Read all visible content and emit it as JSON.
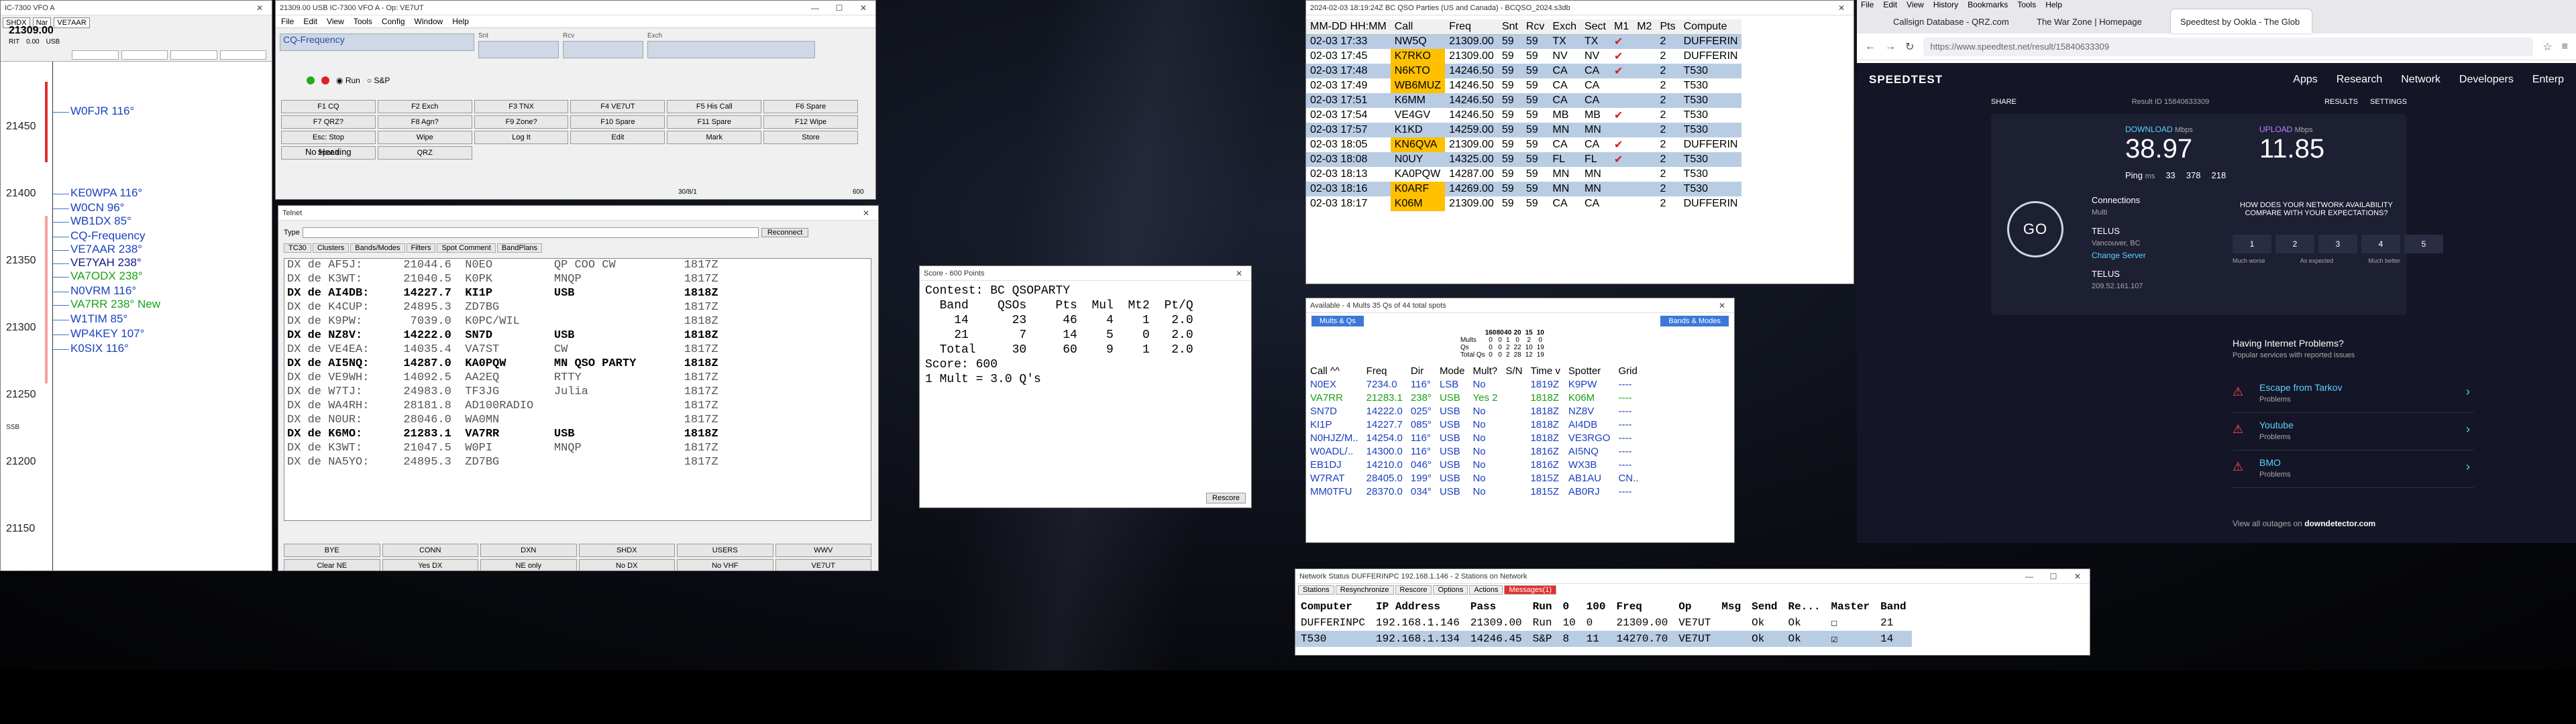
{
  "bandmap": {
    "title": "IC-7300 VFO A",
    "freq": "21309.00",
    "buttons": [
      "SHDX",
      "Nar",
      "VE7AAR"
    ],
    "rit": "RIT",
    "rit_val": "0.00",
    "mode": "USB",
    "ticks": [
      "21450",
      "21400",
      "21350",
      "21300",
      "21250",
      "21200",
      "21150"
    ],
    "spots": [
      {
        "t": "W0FJR 116°",
        "c": "#1a40c0"
      },
      {
        "t": "KE0WPA 116°",
        "c": "#1a40c0"
      },
      {
        "t": "W0CN 96°",
        "c": "#1a40c0"
      },
      {
        "t": "WB1DX 85°",
        "c": "#1a40c0"
      },
      {
        "t": "CQ-Frequency",
        "c": "#1a40c0"
      },
      {
        "t": "VE7AAR 238°",
        "c": "#1a40c0"
      },
      {
        "t": "VE7YAH 238°",
        "c": "#0a1a80"
      },
      {
        "t": "VA7ODX 238°",
        "c": "#18a018"
      },
      {
        "t": "N0VRM 116°",
        "c": "#1a40c0"
      },
      {
        "t": "VA7RR 238° New",
        "c": "#18a018"
      },
      {
        "t": "W1TIM 85°",
        "c": "#1a40c0"
      },
      {
        "t": "WP4KEY 107°",
        "c": "#1a40c0"
      },
      {
        "t": "K0SIX 116°",
        "c": "#1a40c0"
      }
    ],
    "sub_label": "SSB"
  },
  "logger": {
    "title": "21309.00 USB IC-7300 VFO A - Op: VE7UT",
    "menus": [
      "File",
      "Edit",
      "View",
      "Tools",
      "Config",
      "Window",
      "Help"
    ],
    "fields": [
      {
        "l": "",
        "v": "CQ-Frequency"
      },
      {
        "l": "Snt",
        "v": ""
      },
      {
        "l": "Rcv",
        "v": ""
      },
      {
        "l": "Exch",
        "v": ""
      }
    ],
    "run": "Run",
    "sp": "S&P",
    "fkeys": [
      "F1 CQ",
      "F2 Exch",
      "F3 TNX",
      "F4 VE7UT",
      "F5 His Call",
      "F6 Spare",
      "F7 QRZ?",
      "F8 Agn?",
      "F9 Zone?",
      "F10 Spare",
      "F11 Spare",
      "F12 Wipe",
      "Esc: Stop",
      "Wipe",
      "Log It",
      "Edit",
      "Mark",
      "Store",
      "Spot It",
      "QRZ"
    ],
    "heading": "No Heading",
    "status_a": "30/8/1",
    "status_b": "600"
  },
  "telnet": {
    "title": "Telnet",
    "type_label": "Type",
    "reconnect": "Reconnect",
    "tabs": [
      "TC30",
      "Clusters",
      "Bands/Modes",
      "Filters",
      "Spot Comment",
      "BandPlans"
    ],
    "rows": [
      {
        "t": "DX de AF5J:      21044.6  N0EO         QP COO CW          1817Z",
        "b": false
      },
      {
        "t": "DX de K3WT:      21040.5  K0PK         MNQP               1817Z",
        "b": false
      },
      {
        "t": "DX de AI4DB:     14227.7  KI1P         USB                1818Z",
        "b": true
      },
      {
        "t": "DX de K4CUP:     24895.3  ZD7BG                           1817Z",
        "b": false
      },
      {
        "t": "DX de K9PW:       7039.0  K0PC/WIL                        1818Z",
        "b": false
      },
      {
        "t": "DX de NZ8V:      14222.0  SN7D         USB                1818Z",
        "b": true
      },
      {
        "t": "DX de VE4EA:     14035.4  VA7ST        CW                 1817Z",
        "b": false
      },
      {
        "t": "DX de AI5NQ:     14287.0  KA0PQW       MN QSO PARTY       1818Z",
        "b": true
      },
      {
        "t": "DX de VE9WH:     14092.5  AA2EQ        RTTY               1817Z",
        "b": false
      },
      {
        "t": "DX de W7TJ:      24983.0  TF3JG        Julia              1817Z",
        "b": false
      },
      {
        "t": "DX de WA4RH:     28181.8  AD100RADIO                      1817Z",
        "b": false
      },
      {
        "t": "DX de N0UR:      28046.0  WA0MN                           1817Z",
        "b": false
      },
      {
        "t": "DX de K6MO:      21283.1  VA7RR        USB                1818Z",
        "b": true
      },
      {
        "t": "DX de K3WT:      21047.5  W0PI         MNQP               1817Z",
        "b": false
      },
      {
        "t": "DX de NA5YO:     24895.3  ZD7BG                           1817Z",
        "b": false
      }
    ],
    "buttons": [
      "BYE",
      "CONN",
      "DXN",
      "SHDX",
      "USERS",
      "WWV",
      "Clear NE",
      "Yes DX",
      "NE only",
      "No DX",
      "No VHF",
      "VE7UT"
    ]
  },
  "score": {
    "title": "Score - 600 Points",
    "text": "Contest: BC QSOPARTY\n  Band    QSOs    Pts  Mul  Mt2  Pt/Q\n    14      23     46    4    1   2.0\n    21       7     14    5    0   2.0\n  Total     30     60    9    1   2.0\nScore: 600\n1 Mult = 3.0 Q's",
    "rescore": "Rescore"
  },
  "log": {
    "title": "2024-02-03 18:19:24Z BC QSO Parties (US and Canada) - BCQSO_2024.s3db",
    "headers": [
      "MM-DD HH:MM",
      "Call",
      "Freq",
      "Snt",
      "Rcv",
      "Exch",
      "Sect",
      "M1",
      "M2",
      "Pts",
      "Compute"
    ],
    "rows": [
      [
        "02-03 17:33",
        "NW5Q",
        "21309.00",
        "59",
        "59",
        "TX",
        "TX",
        "✔",
        "",
        "2",
        "DUFFERIN"
      ],
      [
        "02-03 17:45",
        "K7RKO",
        "21309.00",
        "59",
        "59",
        "NV",
        "NV",
        "✔",
        "",
        "2",
        "DUFFERIN"
      ],
      [
        "02-03 17:48",
        "N6KTO",
        "14246.50",
        "59",
        "59",
        "CA",
        "CA",
        "✔",
        "",
        "2",
        "T530"
      ],
      [
        "02-03 17:49",
        "WB6MUZ",
        "14246.50",
        "59",
        "59",
        "CA",
        "CA",
        "",
        "",
        "2",
        "T530"
      ],
      [
        "02-03 17:51",
        "K6MM",
        "14246.50",
        "59",
        "59",
        "CA",
        "CA",
        "",
        "",
        "2",
        "T530"
      ],
      [
        "02-03 17:54",
        "VE4GV",
        "14246.50",
        "59",
        "59",
        "MB",
        "MB",
        "✔",
        "",
        "2",
        "T530"
      ],
      [
        "02-03 17:57",
        "K1KD",
        "14259.00",
        "59",
        "59",
        "MN",
        "MN",
        "",
        "",
        "2",
        "T530"
      ],
      [
        "02-03 18:05",
        "KN6QVA",
        "21309.00",
        "59",
        "59",
        "CA",
        "CA",
        "✔",
        "",
        "2",
        "DUFFERIN"
      ],
      [
        "02-03 18:08",
        "N0UY",
        "14325.00",
        "59",
        "59",
        "FL",
        "FL",
        "✔",
        "",
        "2",
        "T530"
      ],
      [
        "02-03 18:13",
        "KA0PQW",
        "14287.00",
        "59",
        "59",
        "MN",
        "MN",
        "",
        "",
        "2",
        "T530"
      ],
      [
        "02-03 18:16",
        "K0ARF",
        "14269.00",
        "59",
        "59",
        "MN",
        "MN",
        "",
        "",
        "2",
        "T530"
      ],
      [
        "02-03 18:17",
        "K06M",
        "21309.00",
        "59",
        "59",
        "CA",
        "CA",
        "",
        "",
        "2",
        "DUFFERIN"
      ]
    ],
    "highlight": [
      1,
      2,
      3,
      7,
      10,
      11
    ]
  },
  "available": {
    "title": "Available - 4 Mults 35 Qs of 44 total spots",
    "btn_a": "Mults & Qs",
    "btn_b": "Bands & Modes",
    "grid_head": [
      "160",
      "80",
      "40",
      "20",
      "15",
      "10"
    ],
    "grid_rows": [
      {
        "l": "Mults",
        "v": [
          "0",
          "0",
          "1",
          "0",
          "2",
          "0"
        ]
      },
      {
        "l": "Qs",
        "v": [
          "0",
          "0",
          "2",
          "22",
          "10",
          "19"
        ]
      },
      {
        "l": "Total Qs",
        "v": [
          "0",
          "0",
          "2",
          "28",
          "12",
          "19"
        ]
      }
    ],
    "headers": [
      "Call ^^",
      "Freq",
      "Dir",
      "Mode",
      "Mult?",
      "S/N",
      "Time v",
      "Spotter",
      "Grid"
    ],
    "rows": [
      {
        "c": [
          "N0EX",
          "7234.0",
          "116°",
          "LSB",
          "No",
          "",
          "1819Z",
          "K9PW",
          "----"
        ],
        "k": "blue"
      },
      {
        "c": [
          "VA7RR",
          "21283.1",
          "238°",
          "USB",
          "Yes 2",
          "",
          "1818Z",
          "K06M",
          "----"
        ],
        "k": "green"
      },
      {
        "c": [
          "SN7D",
          "14222.0",
          "025°",
          "USB",
          "No",
          "",
          "1818Z",
          "NZ8V",
          "----"
        ],
        "k": "blue"
      },
      {
        "c": [
          "KI1P",
          "14227.7",
          "085°",
          "USB",
          "No",
          "",
          "1818Z",
          "AI4DB",
          "----"
        ],
        "k": "blue"
      },
      {
        "c": [
          "N0HJZ/M..",
          "14254.0",
          "116°",
          "USB",
          "No",
          "",
          "1818Z",
          "VE3RGO",
          "----"
        ],
        "k": "blue"
      },
      {
        "c": [
          "W0ADL/..",
          "14300.0",
          "116°",
          "USB",
          "No",
          "",
          "1816Z",
          "AI5NQ",
          "----"
        ],
        "k": "blue"
      },
      {
        "c": [
          "EB1DJ",
          "14210.0",
          "046°",
          "USB",
          "No",
          "",
          "1816Z",
          "WX3B",
          "----"
        ],
        "k": "blue"
      },
      {
        "c": [
          "W7RAT",
          "28405.0",
          "199°",
          "USB",
          "No",
          "",
          "1815Z",
          "AB1AU",
          "CN.."
        ],
        "k": "blue"
      },
      {
        "c": [
          "MM0TFU",
          "28370.0",
          "034°",
          "USB",
          "No",
          "",
          "1815Z",
          "AB0RJ",
          "----"
        ],
        "k": "blue"
      }
    ]
  },
  "network": {
    "title": "Network Status DUFFERINPC 192.168.1.146 - 2 Stations on Network",
    "tabs": [
      "Stations",
      "Resynchronize",
      "Rescore",
      "Options",
      "Actions",
      "Messages(1)"
    ],
    "headers": [
      "Computer",
      "IP Address",
      "Pass",
      "Run",
      "0",
      "100",
      "Freq",
      "Op",
      "Msg",
      "Send",
      "Re...",
      "Master",
      "Band"
    ],
    "rows": [
      [
        "DUFFERINPC",
        "192.168.1.146",
        "21309.00",
        "Run",
        "10",
        "0",
        "21309.00",
        "VE7UT",
        "",
        "Ok",
        "Ok",
        "☐",
        "21"
      ],
      [
        "T530",
        "192.168.1.134",
        "14246.45",
        "S&P",
        "8",
        "11",
        "14270.70",
        "VE7UT",
        "",
        "Ok",
        "Ok",
        "☑",
        "14"
      ]
    ]
  },
  "browser": {
    "menus": [
      "File",
      "Edit",
      "View",
      "History",
      "Bookmarks",
      "Tools",
      "Help"
    ],
    "tabs": [
      "Callsign Database - QRZ.com",
      "The War Zone | Homepage",
      "Speedtest by Ookla - The Glob"
    ],
    "url": "https://www.speedtest.net/result/15840633309",
    "nav": [
      "Apps",
      "Research",
      "Network",
      "Developers",
      "Enterp"
    ],
    "logo": "SPEEDTEST",
    "share": "SHARE",
    "result_id": "Result ID 15840633309",
    "results": "RESULTS",
    "settings": "SETTINGS",
    "download_label": "DOWNLOAD",
    "upload_label": "UPLOAD",
    "unit": "Mbps",
    "download": "38.97",
    "upload": "11.85",
    "ping_label": "Ping",
    "ping_unit": "ms",
    "ping": "33",
    "jitter_a": "378",
    "jitter_b": "218",
    "go": "GO",
    "connections": "Connections",
    "conn_val": "Multi",
    "isp": "TELUS",
    "location": "Vancouver, BC",
    "change": "Change Server",
    "host": "TELUS",
    "ip": "209.52.161.107",
    "compare": "HOW DOES YOUR NETWORK AVAILABILITY COMPARE WITH YOUR EXPECTATIONS?",
    "rating": [
      "1",
      "2",
      "3",
      "4",
      "5"
    ],
    "rating_low": "Much worse",
    "rating_mid": "As expected",
    "rating_high": "Much better",
    "problems_title": "Having Internet Problems?",
    "problems_sub": "Popular services with reported issues",
    "issues": [
      {
        "n": "Escape from Tarkov",
        "s": "Problems"
      },
      {
        "n": "Youtube",
        "s": "Problems"
      },
      {
        "n": "BMO",
        "s": "Problems"
      }
    ],
    "outages": "View all outages on",
    "outages_link": "downdetector.com"
  }
}
